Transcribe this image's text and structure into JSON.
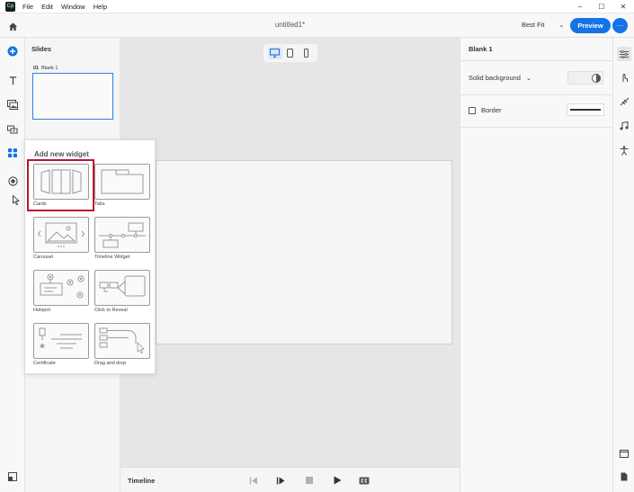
{
  "app": {
    "logo_text": "Cp",
    "menu": [
      "File",
      "Edit",
      "Window",
      "Help"
    ],
    "window_controls": {
      "minimize": "–",
      "maximize": "☐",
      "close": "✕"
    }
  },
  "header": {
    "doc_title": "untitled1*",
    "fit_label": "Best Fit",
    "fit_chevron": "⌄",
    "preview_label": "Preview",
    "more_label": "···"
  },
  "colors": {
    "accent": "#1473e6",
    "selection_outline": "#b5172c",
    "slide_outline": "#2d7ee3"
  },
  "left_toolbar": {
    "icons": [
      "home-icon",
      "add-icon",
      "text-icon",
      "media-icon",
      "interaction-icon",
      "widget-icon",
      "record-icon",
      "panel-toggle-icon"
    ]
  },
  "slides_panel": {
    "title": "Slides",
    "slides": [
      {
        "number": "01",
        "name": "Blank 1"
      }
    ]
  },
  "widget_popup": {
    "title": "Add new widget",
    "selected": "Cards",
    "widgets": [
      {
        "id": "cards",
        "label": "Cards"
      },
      {
        "id": "tabs",
        "label": "Tabs"
      },
      {
        "id": "carousel",
        "label": "Carousel"
      },
      {
        "id": "timeline",
        "label": "Timeline Widget"
      },
      {
        "id": "hotspot",
        "label": "Hotspot"
      },
      {
        "id": "reveal",
        "label": "Click to Reveal"
      },
      {
        "id": "certificate",
        "label": "Certificate"
      },
      {
        "id": "dragdrop",
        "label": "Drag and drop"
      }
    ]
  },
  "timeline": {
    "label": "Timeline",
    "controls": [
      "step-back-icon",
      "play-pause-icon",
      "stop-icon",
      "play-icon",
      "closed-caption-icon"
    ]
  },
  "properties": {
    "title": "Blank 1",
    "background_label": "Solid background",
    "border_label": "Border",
    "border_checked": false
  },
  "right_toolbar": {
    "icons": [
      "properties-icon",
      "interactions-icon",
      "animation-icon",
      "audio-icon",
      "accessibility-icon",
      "layout-icon",
      "notes-icon"
    ]
  }
}
